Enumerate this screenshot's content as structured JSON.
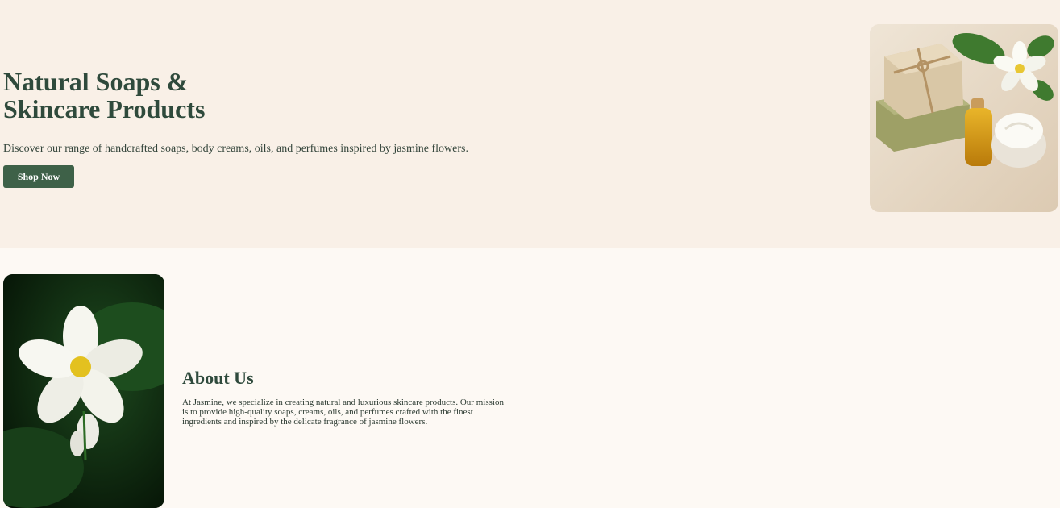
{
  "hero": {
    "title": "Natural Soaps &\nSkincare Products",
    "subtitle": "Discover our range of handcrafted soaps, body creams, oils, and perfumes inspired by jasmine flowers.",
    "cta_label": "Shop Now",
    "image_icon": "soap-products-image"
  },
  "about": {
    "title": "About Us",
    "text": "At Jasmine, we specialize in creating natural and luxurious skincare products. Our mission is to provide high-quality soaps, creams, oils, and perfumes crafted with the finest ingredients and inspired by the delicate fragrance of jasmine flowers.",
    "image_icon": "jasmine-flower-image"
  },
  "colors": {
    "hero_bg": "#f9f0e7",
    "page_bg": "#fdf9f4",
    "accent": "#3e6148",
    "heading": "#2f4a3c"
  }
}
